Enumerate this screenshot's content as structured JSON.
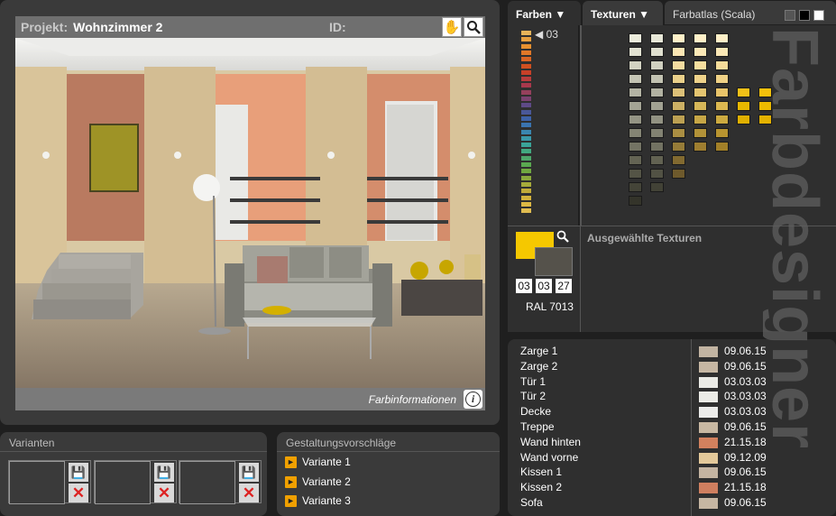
{
  "project": {
    "label": "Projekt:",
    "name": "Wohnzimmer 2",
    "id_label": "ID:",
    "id_value": ""
  },
  "viewer": {
    "info_label": "Farbinformationen",
    "hand_icon": "hand-icon",
    "zoom_icon": "magnifier-icon"
  },
  "variants": {
    "title": "Varianten",
    "slots": 3
  },
  "proposals": {
    "title": "Gestaltungsvorschläge",
    "items": [
      "Variante 1",
      "Variante 2",
      "Variante 3"
    ]
  },
  "tabs": {
    "farben": "Farben",
    "texturen": "Texturen",
    "farbatlas": "Farbatlas (Scala)"
  },
  "color_strip": {
    "selected_index": "03"
  },
  "selection": {
    "textures_label": "Ausgewählte Texturen",
    "codes": [
      "03",
      "03",
      "27"
    ],
    "ral": "RAL 7013",
    "primary_color": "#f5c800",
    "secondary_color": "#55524b"
  },
  "list": [
    {
      "name": "Zarge 1",
      "date": "09.06.15",
      "color": "#c2b4a2"
    },
    {
      "name": "Zarge 2",
      "date": "09.06.15",
      "color": "#c6b7a3"
    },
    {
      "name": "Tür 1",
      "date": "03.03.03",
      "color": "#ebebe6"
    },
    {
      "name": "Tür 2",
      "date": "03.03.03",
      "color": "#ebebe6"
    },
    {
      "name": "Decke",
      "date": "03.03.03",
      "color": "#ececea"
    },
    {
      "name": "Treppe",
      "date": "09.06.15",
      "color": "#c8b8a2"
    },
    {
      "name": "Wand hinten",
      "date": "21.15.18",
      "color": "#d2815e"
    },
    {
      "name": "Wand vorne",
      "date": "09.12.09",
      "color": "#e4c99a"
    },
    {
      "name": "Kissen 1",
      "date": "09.06.15",
      "color": "#c4b4a1"
    },
    {
      "name": "Kissen 2",
      "date": "21.15.18",
      "color": "#cf7f5f"
    },
    {
      "name": "Sofa",
      "date": "09.06.15",
      "color": "#c6b6a2"
    }
  ],
  "watermark": "Farbdesigner",
  "strip_colors": [
    "#e8b45a",
    "#e8a040",
    "#e69030",
    "#e07828",
    "#d86424",
    "#cf5020",
    "#c74028",
    "#b83c3c",
    "#a8384c",
    "#95405c",
    "#7a4270",
    "#5e4a86",
    "#4a5898",
    "#3e62a6",
    "#3a74b0",
    "#3a86b0",
    "#3a98a8",
    "#3aa498",
    "#42a880",
    "#4ea66a",
    "#5aa850",
    "#70a840",
    "#8aa83c",
    "#a6aa3a",
    "#c0aa3a",
    "#d2b23c",
    "#dcb844",
    "#e0bc50"
  ],
  "grid_colors": [
    [
      "#ececdc",
      "#e8e8d8",
      "#fff0c8",
      "#fff0c8",
      "#fff0c8"
    ],
    [
      "#e2e2d2",
      "#e0e0d0",
      "#fbe6b4",
      "#fbe8b6",
      "#fbe8b6"
    ],
    [
      "#d2d2c2",
      "#d0d0c0",
      "#f4dca0",
      "#f6de9e",
      "#f6dc9a"
    ],
    [
      "#c4c4b4",
      "#c2c2b2",
      "#ead08a",
      "#eed28a",
      "#f0d286"
    ],
    [
      "#b4b4a4",
      "#b2b2a2",
      "#dcc078",
      "#e4c470",
      "#e8c46a",
      "#f0c018",
      "#f2c00c"
    ],
    [
      "#a4a494",
      "#a2a292",
      "#ccb064",
      "#d6b658",
      "#dcb850",
      "#e8b800",
      "#ecba00"
    ],
    [
      "#949484",
      "#929282",
      "#bca052",
      "#c6a646",
      "#ccaa40",
      "#e0b000",
      "#e4b200"
    ],
    [
      "#848474",
      "#828272",
      "#aa8e42",
      "#b29238",
      "#b89430"
    ],
    [
      "#747464",
      "#727262",
      "#967c38",
      "#9e7e30",
      "#a28028"
    ],
    [
      "#646454",
      "#626252",
      "#826a30"
    ],
    [
      "#545446",
      "#525244",
      "#6e5a2c"
    ],
    [
      "#444438",
      "#424236"
    ],
    [
      "#34342a"
    ]
  ]
}
